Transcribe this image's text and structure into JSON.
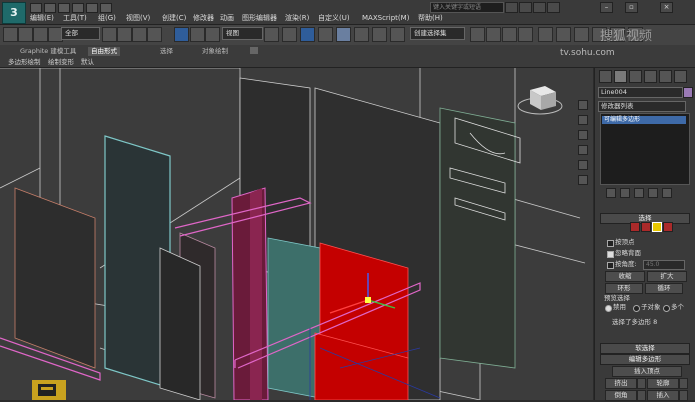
{
  "app": {
    "logo_text": "3"
  },
  "menu": [
    "编辑(E)",
    "工具(T)",
    "组(G)",
    "视图(V)",
    "创建(C)",
    "修改器",
    "动画",
    "图形编辑器",
    "渲染(R)",
    "自定义(U)",
    "MAXScript(M)",
    "帮助(H)"
  ],
  "search": {
    "placeholder": "键入关键字或短语"
  },
  "toolbar": {
    "filter_dropdown": "全部",
    "refcoord_dropdown": "视图",
    "selection_set": "创建选择集"
  },
  "ribbon": {
    "tabs": [
      "Graphite 建模工具",
      "自由形式",
      "选择",
      "对象绘制"
    ],
    "active_tab": "自由形式",
    "subtabs": [
      "多边形绘制",
      "绘制变形",
      "默认"
    ]
  },
  "watermark": {
    "line1": "搜狐视频",
    "line2": "tv.sohu.com"
  },
  "panel": {
    "object_name": "Line004",
    "modifier_list": "修改器列表",
    "stack_item": "可编辑多边形",
    "selection": {
      "title": "选择",
      "by_vertex": "按顶点",
      "ignore_backfacing": "忽略背面",
      "by_angle": "按角度:",
      "angle_value": "45.0",
      "shrink": "收缩",
      "grow": "扩大",
      "ring": "环形",
      "loop": "循环",
      "preview_title": "预览选择",
      "preview_off": "禁用",
      "preview_subobj": "子对象",
      "preview_multi": "多个",
      "status": "选择了多边形 8"
    },
    "soft_selection": {
      "title": "软选择"
    },
    "edit_polygons": {
      "title": "编辑多边形",
      "insert_vertex": "插入顶点",
      "extrude": "挤出",
      "outline": "轮廓",
      "bevel": "倒角",
      "inset": "插入"
    }
  },
  "colors": {
    "selected_face": "#c40000",
    "wall_frame": "#e066c8",
    "accent": "#3e6aa8"
  }
}
